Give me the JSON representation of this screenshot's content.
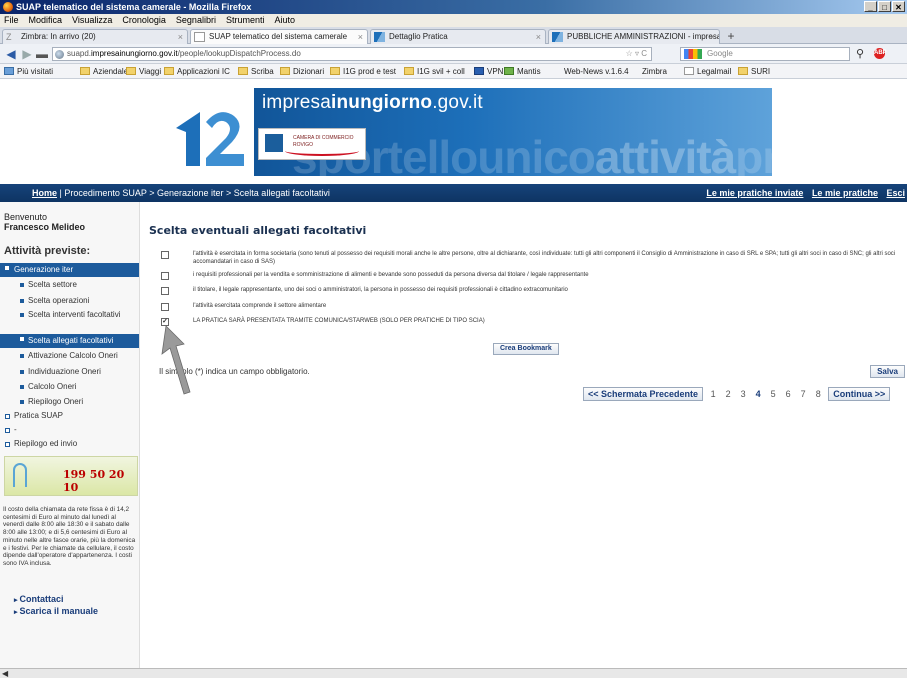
{
  "window": {
    "title": "SUAP telematico del sistema camerale - Mozilla Firefox",
    "controls": [
      "_",
      "□",
      "✕"
    ]
  },
  "menu": [
    "File",
    "Modifica",
    "Visualizza",
    "Cronologia",
    "Segnalibri",
    "Strumenti",
    "Aiuto"
  ],
  "tabs": [
    {
      "label": "Zimbra: In arrivo (20)"
    },
    {
      "label": "SUAP telematico del sistema camerale"
    },
    {
      "label": "Dettaglio Pratica"
    },
    {
      "label": "PUBBLICHE AMMINISTRAZIONI - impresa..."
    }
  ],
  "address": {
    "prefix": "suapd.",
    "domain": "impresainungiorno.gov.it",
    "path": "/people/lookupDispatchProcess.do",
    "icons": "☆ ▿ C"
  },
  "search": {
    "placeholder": "Google"
  },
  "bookmarks": [
    "Più visitati",
    "Aziendale",
    "Viaggi",
    "Applicazioni IC",
    "Scriba",
    "Dizionari",
    "I1G prod e test",
    "I1G svil + coll",
    "VPN",
    "Mantis",
    "Web-News v.1.6.4",
    "Zimbra",
    "Legalmail",
    "SURI"
  ],
  "site": {
    "wordmark_a": "impresa",
    "wordmark_b": "inungiorno",
    "wordmark_c": ".gov.it",
    "chamber_line1": "CAMERA DI COMMERCIO",
    "chamber_line2": "ROVIGO",
    "bg_word_a": "sportellounico",
    "bg_word_b": "attività",
    "bg_word_c": "produttive"
  },
  "nav": {
    "home": "Home",
    "crumbs": "| Procedimento SUAP > Generazione iter > Scelta allegati facoltativi",
    "inviate": "Le mie pratiche inviate",
    "pratiche": "Le mie pratiche",
    "esci": "Esci"
  },
  "sidebar": {
    "welcome": "Benvenuto",
    "user": "Francesco Melideo",
    "section": "Attività previste:",
    "items": [
      {
        "label": "Generazione iter"
      },
      {
        "label": "Scelta settore"
      },
      {
        "label": "Scelta operazioni"
      },
      {
        "label": "Scelta interventi facoltativi"
      },
      {
        "label": "Scelta allegati facoltativi"
      },
      {
        "label": "Attivazione Calcolo Oneri"
      },
      {
        "label": "Individuazione Oneri"
      },
      {
        "label": "Calcolo Oneri"
      },
      {
        "label": "Riepilogo Oneri"
      },
      {
        "label": "Pratica SUAP"
      },
      {
        "label": "-"
      },
      {
        "label": "Riepilogo ed invio"
      }
    ],
    "phone": "199 50 20 10",
    "note": "Il costo della chiamata da rete fissa è di 14,2 centesimi di Euro al minuto dal lunedì al venerdì dalle 8:00 alle 18:30 e il sabato dalle 8:00 alle 13:00; e di 5,6 centesimi di Euro al minuto nelle altre fasce orarie, più la domenica e i festivi. Per le chiamate da cellulare, il costo dipende dall'operatore d'appartenenza. I costi sono IVA inclusa.",
    "contact": "Contattaci",
    "manual": "Scarica il manuale"
  },
  "main": {
    "title": "Scelta eventuali allegati facoltativi",
    "options": [
      {
        "text": "l'attività è esercitata in forma societaria (sono tenuti al possesso dei requisiti morali anche le altre persone, oltre al dichiarante, così individuate: tutti gli altri componenti il Consiglio di Amministrazione in caso di SRL e SPA; tutti gli altri soci in caso di SNC; gli altri soci accomandatari in caso di SAS)",
        "checked": ""
      },
      {
        "text": "i requisiti professionali per la vendita e somministrazione di alimenti e bevande sono posseduti da persona diversa dal titolare / legale rappresentante",
        "checked": ""
      },
      {
        "text": "il titolare, il legale rappresentante, uno dei soci o amministratori, la persona in possesso dei requisiti professionali è cittadino extracomunitario",
        "checked": ""
      },
      {
        "text": "l'attività esercitata comprende il settore alimentare",
        "checked": ""
      },
      {
        "text": "LA PRATICA SARÀ PRESENTATA TRAMITE COMUNICA/STARWEB (SOLO PER PRATICHE DI TIPO SCIA)",
        "checked": "✓"
      }
    ],
    "bookmark_button": "Crea Bookmark",
    "required_note": "Il simbolo (*) indica un campo obbligatorio.",
    "save_button": "Salva",
    "pager": {
      "prev": "<< Schermata Precedente",
      "pages": [
        "1",
        "2",
        "3",
        "4",
        "5",
        "6",
        "7",
        "8"
      ],
      "current": "4",
      "next": "Continua >>"
    }
  },
  "colors": {
    "nav_bar": "#0e3463",
    "side_highlight": "#1d5b9c",
    "link": "#1a3d7a",
    "phone_number": "#bb0000"
  }
}
